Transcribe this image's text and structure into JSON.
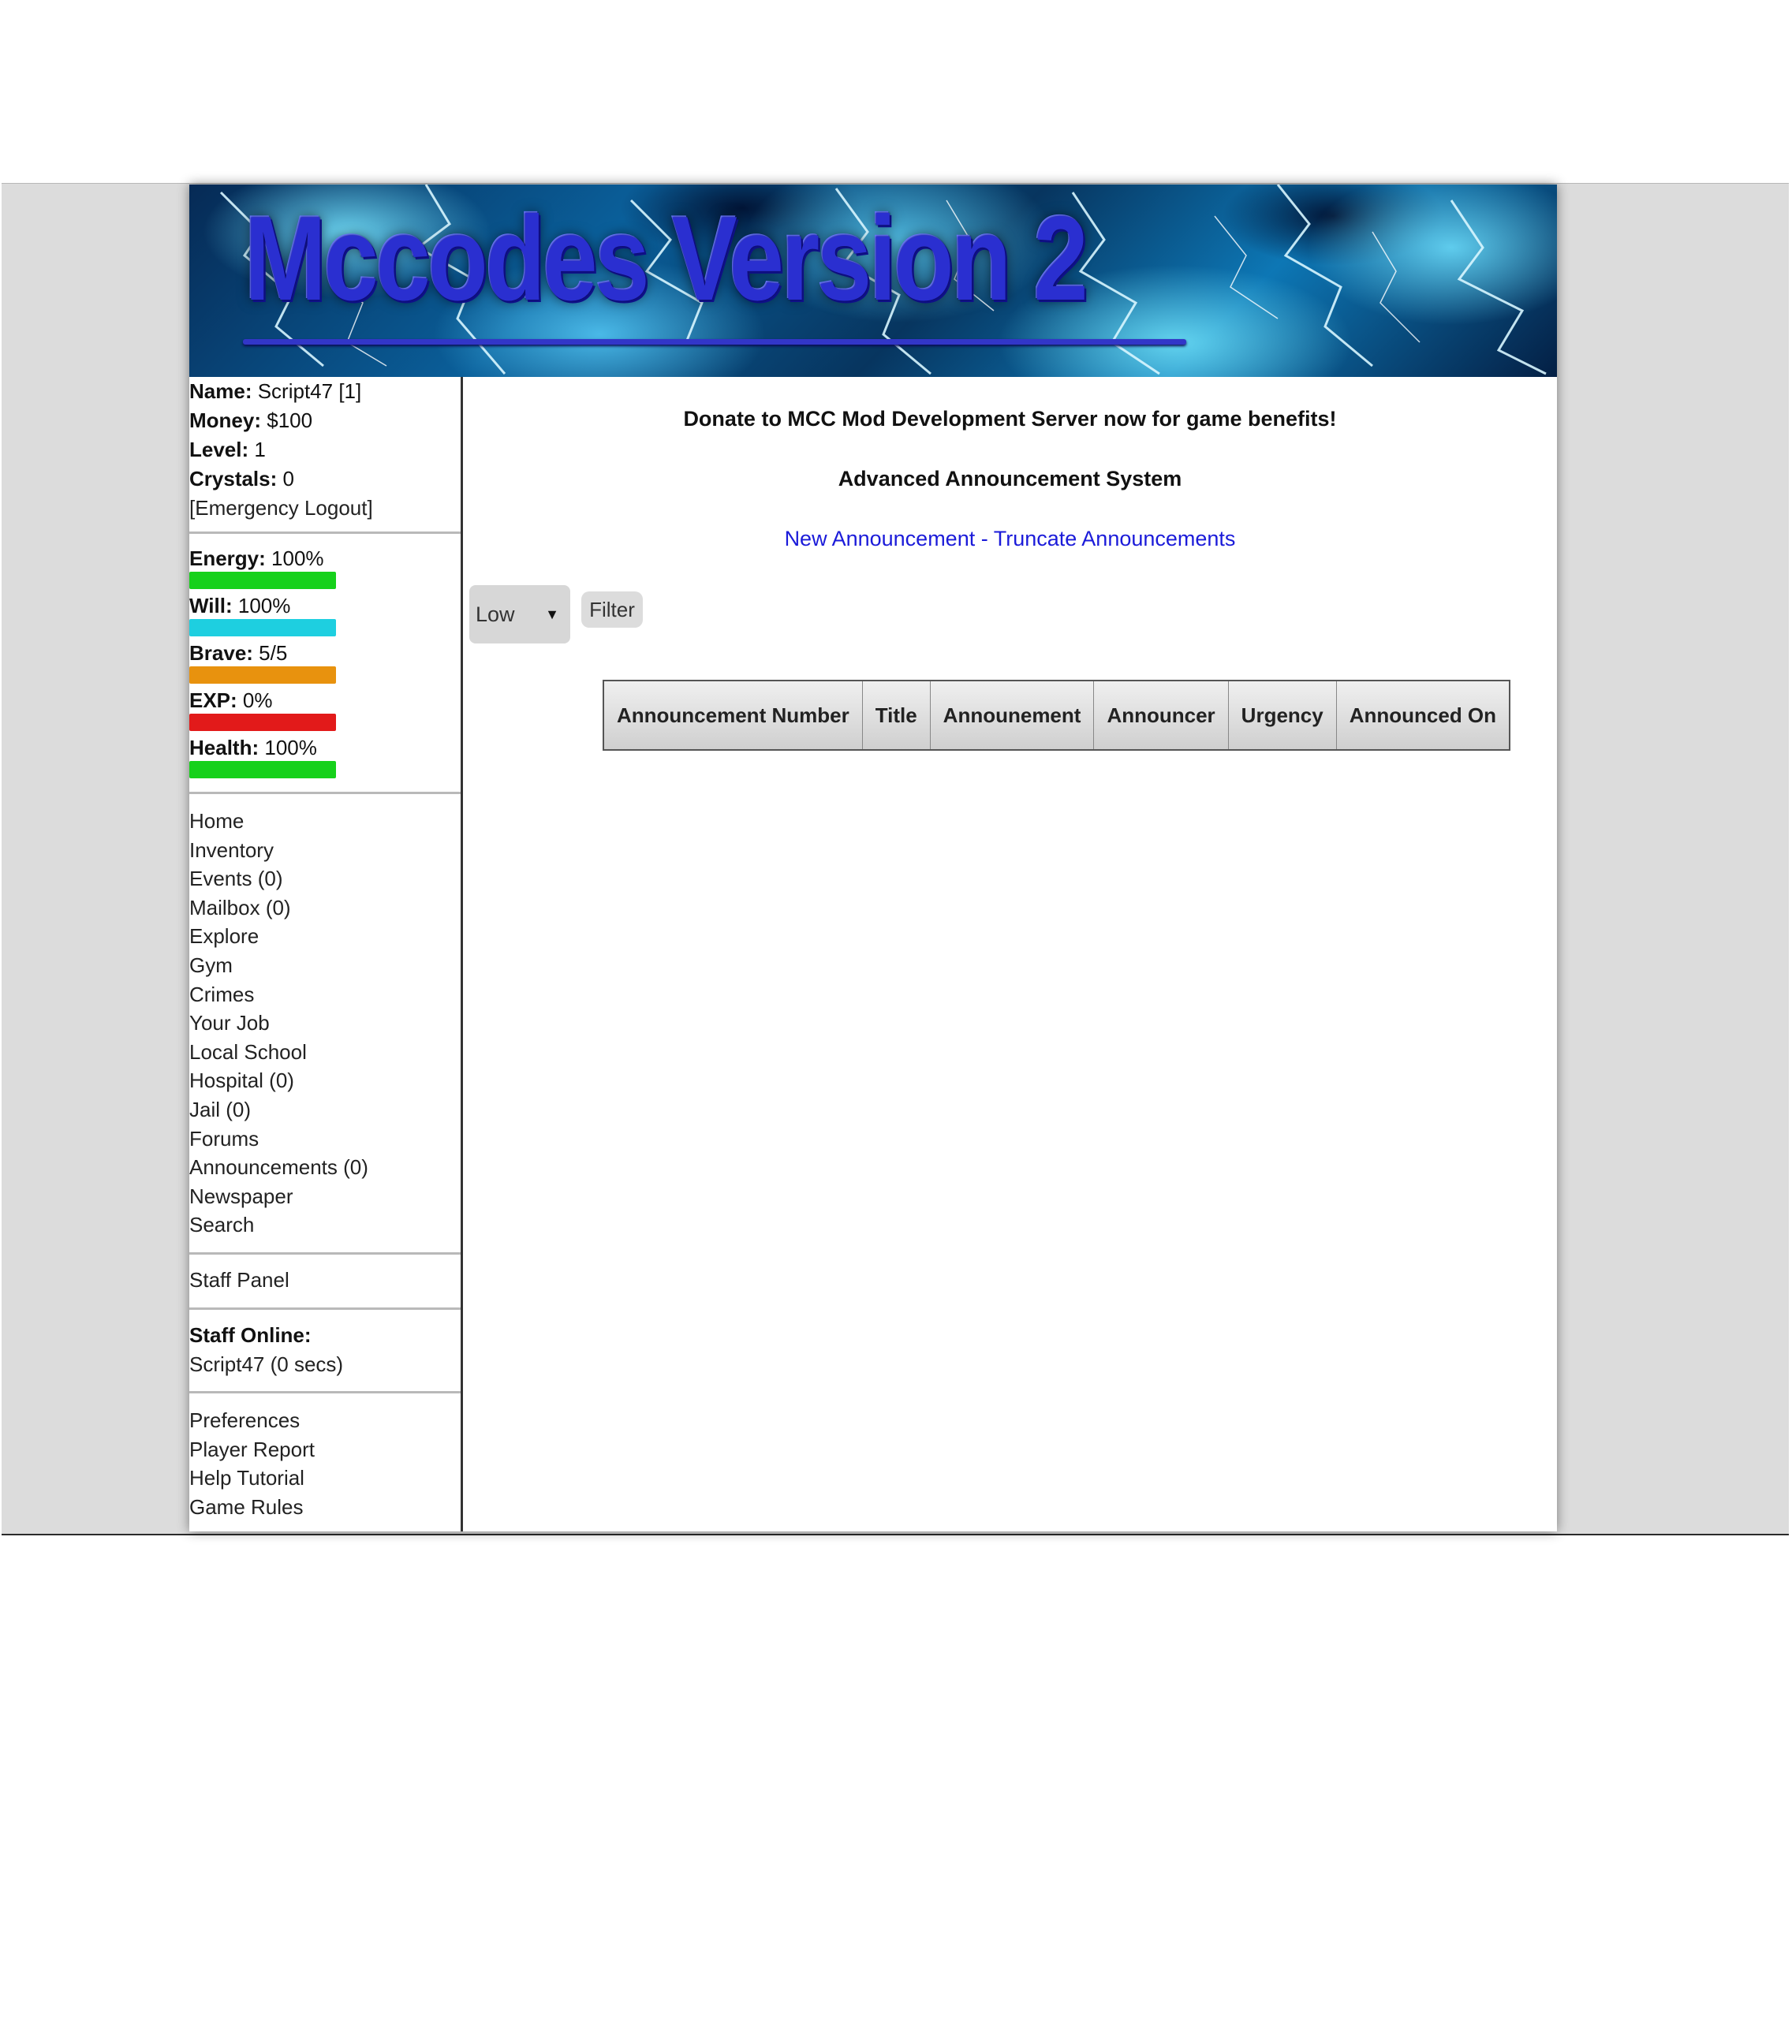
{
  "banner": {
    "title": "Mccodes Version 2"
  },
  "user": {
    "name_label": "Name:",
    "name_value": "Script47 [1]",
    "money_label": "Money:",
    "money_value": "$100",
    "level_label": "Level:",
    "level_value": "1",
    "crystals_label": "Crystals:",
    "crystals_value": "0",
    "logout_label": "[Emergency Logout]"
  },
  "stats": [
    {
      "label": "Energy:",
      "value": "100%",
      "fill": 1.0,
      "color": "#16d11b"
    },
    {
      "label": "Will:",
      "value": "100%",
      "fill": 1.0,
      "color": "#1ecfe0"
    },
    {
      "label": "Brave:",
      "value": "5/5",
      "fill": 1.0,
      "color": "#e8920e"
    },
    {
      "label": "EXP:",
      "value": "0%",
      "fill": 1.0,
      "color": "#e21a1a"
    },
    {
      "label": "Health:",
      "value": "100%",
      "fill": 1.0,
      "color": "#16d11b"
    }
  ],
  "nav": [
    "Home",
    "Inventory",
    "Events (0)",
    "Mailbox (0)",
    "Explore",
    "Gym",
    "Crimes",
    "Your Job",
    "Local School",
    "Hospital (0)",
    "Jail (0)",
    "Forums",
    "Announcements (0)",
    "Newspaper",
    "Search"
  ],
  "staff_panel": "Staff Panel",
  "staff_online": {
    "label": "Staff Online:",
    "entry": "Script47 (0 secs)"
  },
  "footer_links": [
    "Preferences",
    "Player Report",
    "Help Tutorial",
    "Game Rules"
  ],
  "main": {
    "donate_text": "Donate to MCC Mod Development Server now for game benefits!",
    "system_title": "Advanced Announcement System",
    "new_link": "New Announcement",
    "separator": " - ",
    "truncate_link": "Truncate Announcements",
    "urgency_selected": "Low",
    "filter_label": "Filter",
    "table_headers": [
      "Announcement Number",
      "Title",
      "Announement",
      "Announcer",
      "Urgency",
      "Announced On"
    ]
  }
}
